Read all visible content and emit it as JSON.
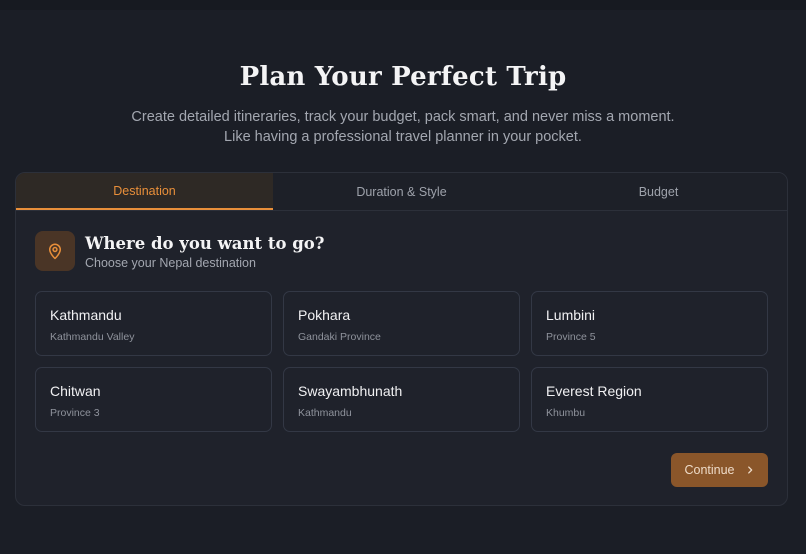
{
  "hero": {
    "title": "Plan Your Perfect Trip",
    "subtitle_line1": "Create detailed itineraries, track your budget, pack smart, and never miss a moment.",
    "subtitle_line2": "Like having a professional travel planner in your pocket."
  },
  "tabs": [
    {
      "label": "Destination",
      "active": true
    },
    {
      "label": "Duration & Style",
      "active": false
    },
    {
      "label": "Budget",
      "active": false
    }
  ],
  "step": {
    "title": "Where do you want to go?",
    "subtitle": "Choose your Nepal destination",
    "icon": "map-pin-icon"
  },
  "destinations": [
    {
      "name": "Kathmandu",
      "region": "Kathmandu Valley"
    },
    {
      "name": "Pokhara",
      "region": "Gandaki Province"
    },
    {
      "name": "Lumbini",
      "region": "Province 5"
    },
    {
      "name": "Chitwan",
      "region": "Province 3"
    },
    {
      "name": "Swayambhunath",
      "region": "Kathmandu"
    },
    {
      "name": "Everest Region",
      "region": "Khumbu"
    }
  ],
  "actions": {
    "continue_label": "Continue",
    "continue_icon": "chevron-right-icon"
  },
  "colors": {
    "accent": "#e98f3a",
    "background": "#1b1e26",
    "card": "#1f222b",
    "button": "#8a562a"
  }
}
